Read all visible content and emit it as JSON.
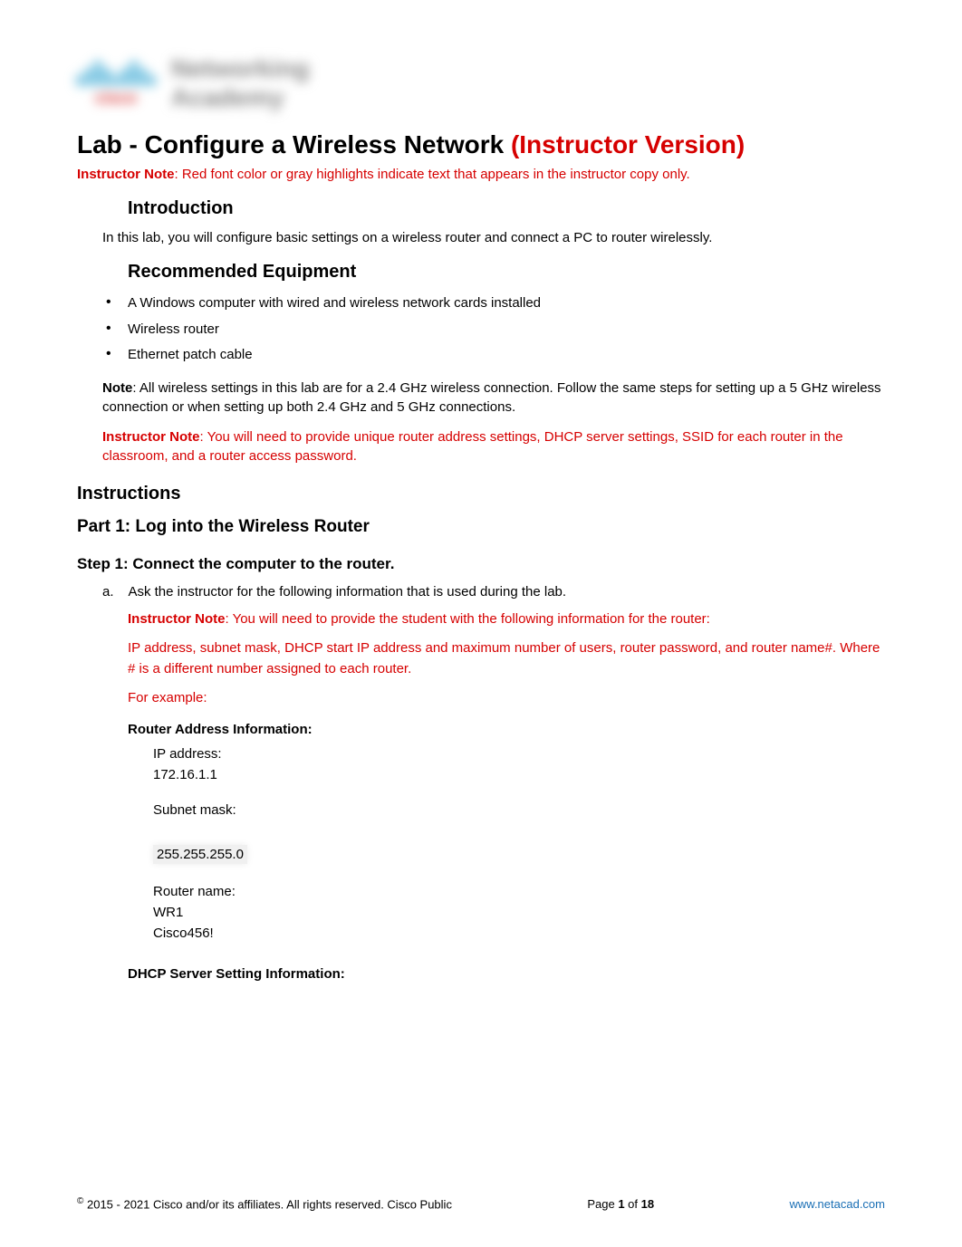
{
  "logo": {
    "brand": "cisco",
    "line1": "Networking",
    "line2": "Academy"
  },
  "title": {
    "main": "Lab - Configure a Wireless Network ",
    "version": "(Instructor Version)"
  },
  "instructor_note_top": {
    "label": "Instructor Note",
    "text": ": Red font color or gray highlights indicate text that appears in the instructor copy only."
  },
  "introduction": {
    "heading": "Introduction",
    "text": "In this lab, you will configure basic settings on a wireless router and connect a PC to router wirelessly."
  },
  "equipment": {
    "heading": "Recommended Equipment",
    "items": [
      "A Windows computer with wired and wireless network cards installed",
      "Wireless router",
      "Ethernet patch cable"
    ]
  },
  "note": {
    "label": "Note",
    "text": ": All wireless settings in this lab are for a 2.4 GHz wireless connection. Follow the same steps for setting up a 5 GHz wireless connection or when setting up both 2.4 GHz and 5 GHz connections."
  },
  "instructor_note_2": {
    "label": "Instructor Note",
    "text": ": You will need to provide unique router address settings, DHCP server settings, SSID for each router in the classroom, and a router access password."
  },
  "instructions": {
    "heading": "Instructions"
  },
  "part1": {
    "heading": "Part 1: Log into the Wireless Router"
  },
  "step1": {
    "heading": "Step 1: Connect the computer to the router.",
    "item_a": {
      "marker": "a.",
      "text": "Ask the instructor for the following information that is used during the lab."
    },
    "instructor_note": {
      "label": "Instructor Note",
      "text": ": You will need to provide the student with the following information for the router:"
    },
    "instructor_detail": "IP address, subnet mask, DHCP start IP address and maximum number of users, router password, and router name#. Where # is a different number assigned to each router.",
    "for_example": "For example:",
    "router_heading": "Router Address Information:",
    "ip_label": "IP address:",
    "ip_value": "172.16.1.1",
    "subnet_label": "Subnet mask:",
    "subnet_value": "255.255.255.0",
    "router_name_label": "Router name:",
    "router_name_value": "WR1",
    "router_password": "Cisco456!",
    "dhcp_heading": "DHCP Server Setting Information:"
  },
  "footer": {
    "copyright": " 2015 - 2021 Cisco and/or its affiliates. All rights reserved. Cisco Public",
    "page_prefix": "Page ",
    "page_current": "1",
    "page_of": " of ",
    "page_total": "18",
    "link": "www.netacad.com"
  }
}
